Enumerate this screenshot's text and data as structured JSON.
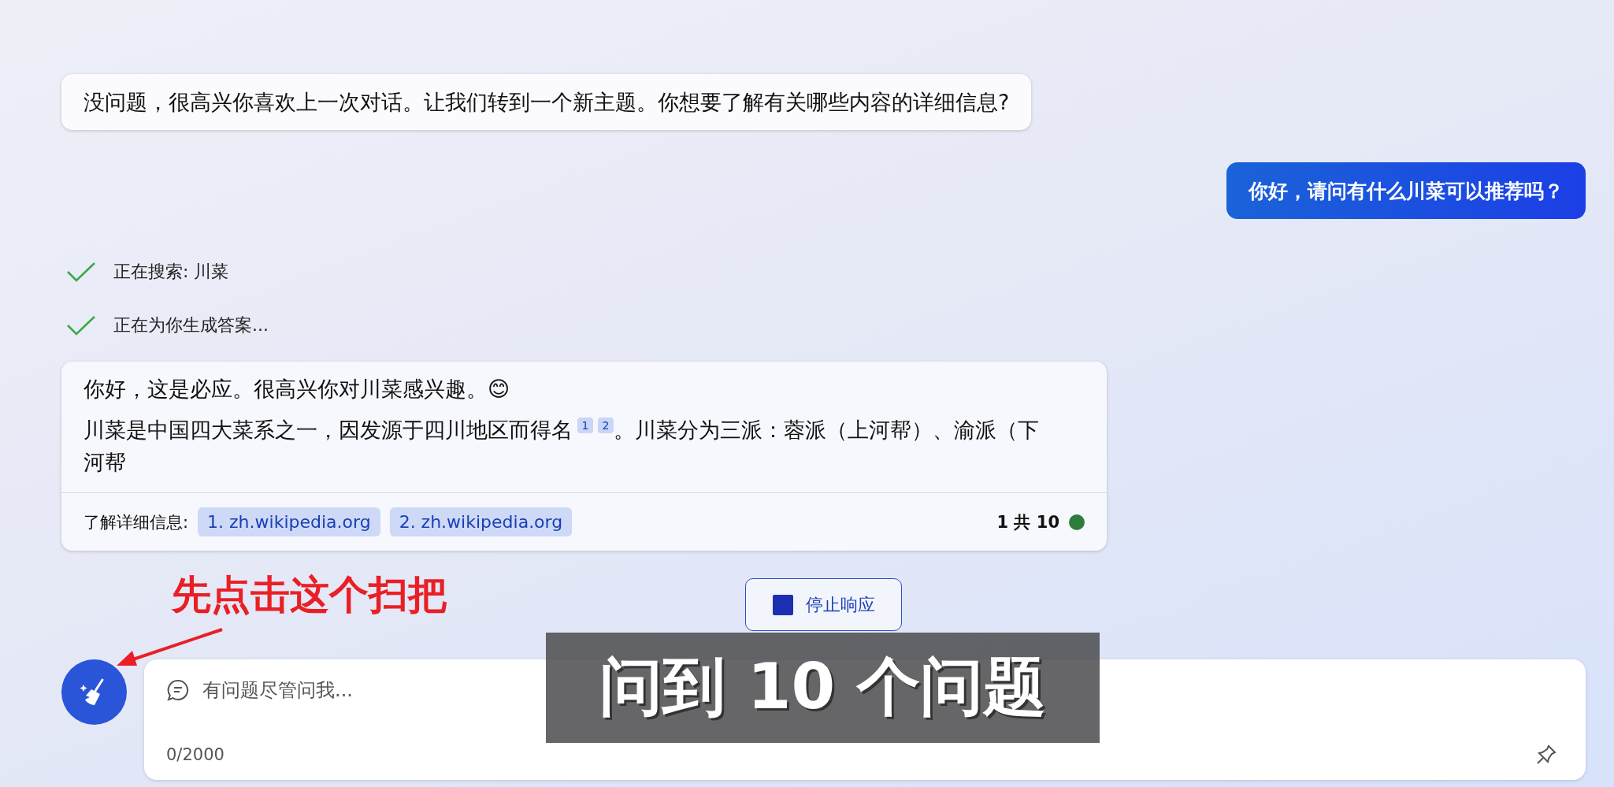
{
  "previous_reply": {
    "text": "没问题，很高兴你喜欢上一次对话。让我们转到一个新主题。你想要了解有关哪些内容的详细信息?"
  },
  "user_message": {
    "text": "你好，请问有什么川菜可以推荐吗？"
  },
  "progress_steps": [
    {
      "text": "正在搜索: 川菜",
      "done": true
    },
    {
      "text": "正在为你生成答案...",
      "done": true
    }
  ],
  "answer": {
    "greeting": "你好，这是必应。很高兴你对川菜感兴趣。😊",
    "body_start": "川菜是中国四大菜系之一，因发源于四川地区而得名",
    "citations": [
      "1",
      "2"
    ],
    "body_end": "。川菜分为三派：蓉派（上河帮）、渝派（下河帮",
    "sources_label": "了解详细信息:",
    "sources": [
      "1. zh.wikipedia.org",
      "2. zh.wikipedia.org"
    ],
    "turn_counter": "1 共 10"
  },
  "stop_button": {
    "label": "停止响应"
  },
  "input": {
    "placeholder": "有问题尽管问我...",
    "counter": "0/2000"
  },
  "annotation": {
    "text": "先点击这个扫把"
  },
  "caption": {
    "text": "问到 10 个问题"
  }
}
